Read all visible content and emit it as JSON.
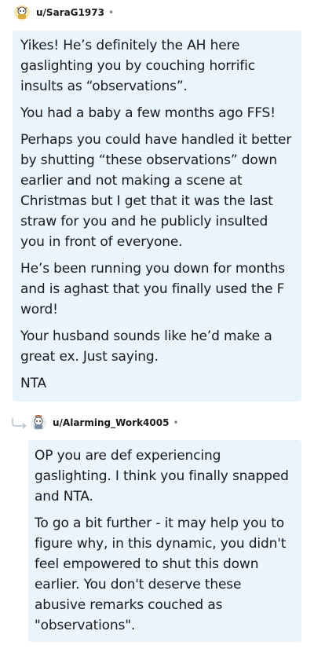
{
  "comments": [
    {
      "username": "u/SaraG1973",
      "separator": "•",
      "avatar_icon": "snoo-avatar-icon",
      "paragraphs": [
        "Yikes! He’s definitely the AH here gaslighting you by couching horrific insults as “observations”.",
        "You had a baby a few months ago FFS!",
        "Perhaps you could have handled it better by shutting “these observations” down earlier and not making a scene at Christmas but I get that it was the last straw for you and he publicly insulted you in front of everyone.",
        "He’s been running you down for months and is aghast that you finally used the F word!",
        "Your husband sounds like he’d make a great ex. Just saying.",
        "NTA"
      ]
    },
    {
      "username": "u/Alarming_Work4005",
      "separator": "•",
      "avatar_icon": "snoo-avatar-icon",
      "reply_icon": "reply-arrow-icon",
      "paragraphs": [
        "OP you are def experiencing gaslighting. I think you finally snapped and NTA.",
        "To go a bit further - it may help you to figure why, in this dynamic, you didn't feel empowered to shut this down earlier. You don't deserve these abusive remarks couched as \"observations\"."
      ]
    }
  ],
  "colors": {
    "bubble_bg": "#eaf4fc",
    "text": "#1a1a1b",
    "meta": "#7c7c7c",
    "reply_arrow": "#b4c4d2"
  }
}
